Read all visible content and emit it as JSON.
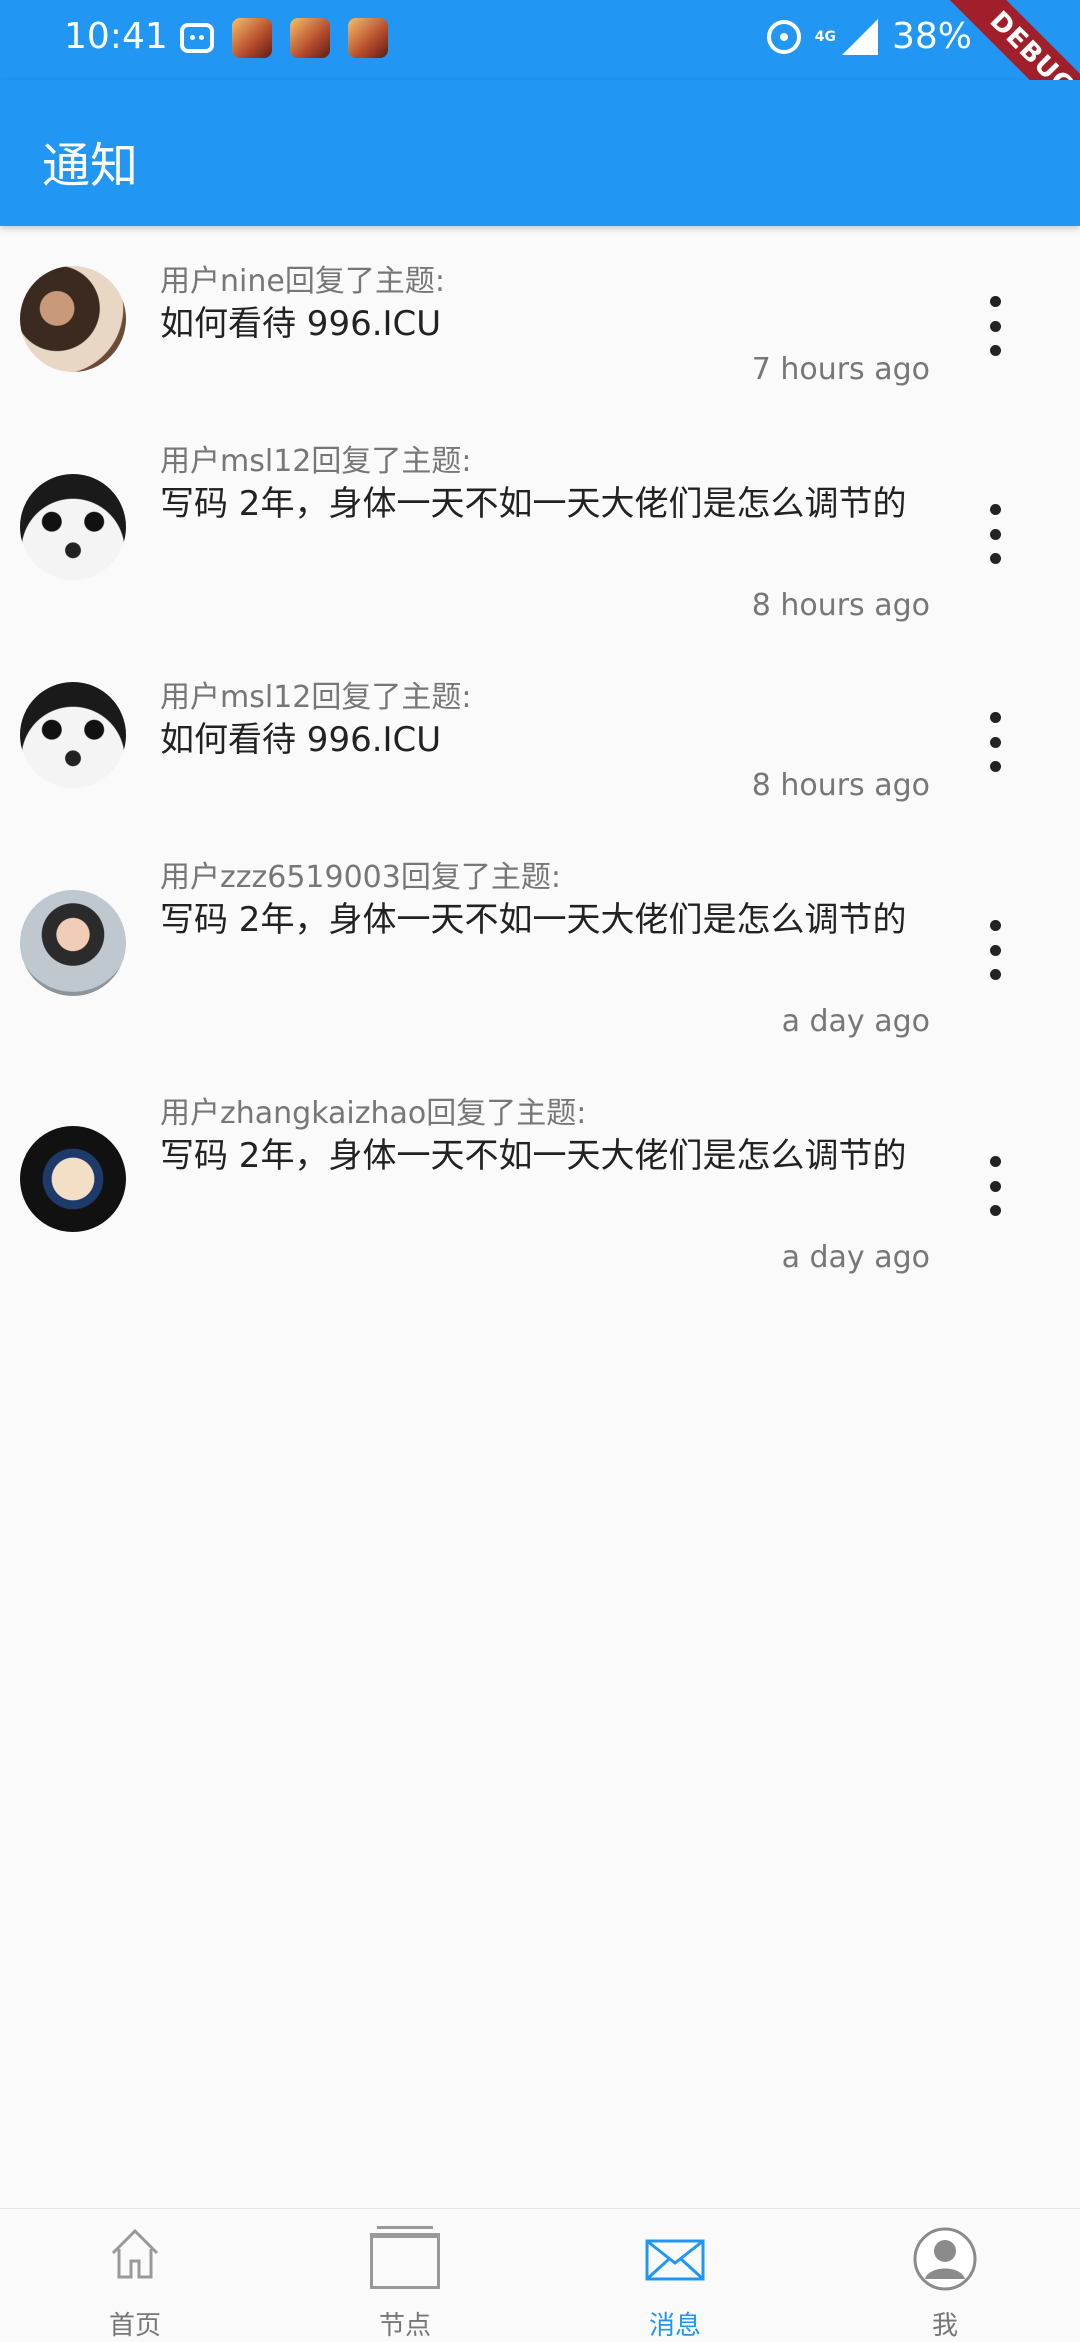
{
  "status_bar": {
    "time": "10:41",
    "network": "4G",
    "battery": "38%"
  },
  "debug_banner": "DEBUG",
  "app_bar": {
    "title": "通知"
  },
  "notifications": [
    {
      "user_reply": "用户nine回复了主题:",
      "topic": "如何看待 996.ICU",
      "time": "7 hours ago",
      "avatar_icon": "user-avatar"
    },
    {
      "user_reply": "用户msl12回复了主题:",
      "topic": "写码 2年，身体一天不如一天大佬们是怎么调节的",
      "time": "8 hours ago",
      "avatar_icon": "panda-avatar"
    },
    {
      "user_reply": "用户msl12回复了主题:",
      "topic": "如何看待 996.ICU",
      "time": "8 hours ago",
      "avatar_icon": "panda-avatar"
    },
    {
      "user_reply": "用户zzz6519003回复了主题:",
      "topic": "写码 2年，身体一天不如一天大佬们是怎么调节的",
      "time": "a day ago",
      "avatar_icon": "user-avatar"
    },
    {
      "user_reply": "用户zhangkaizhao回复了主题:",
      "topic": "写码 2年，身体一天不如一天大佬们是怎么调节的",
      "time": "a day ago",
      "avatar_icon": "dog-avatar"
    }
  ],
  "bottom_nav": {
    "items": [
      {
        "label": "首页",
        "icon": "home-icon"
      },
      {
        "label": "节点",
        "icon": "nodes-icon"
      },
      {
        "label": "消息",
        "icon": "mail-icon",
        "active": true
      },
      {
        "label": "我",
        "icon": "profile-icon"
      }
    ]
  },
  "colors": {
    "primary": "#2196f3",
    "debug": "#a01f2b"
  }
}
